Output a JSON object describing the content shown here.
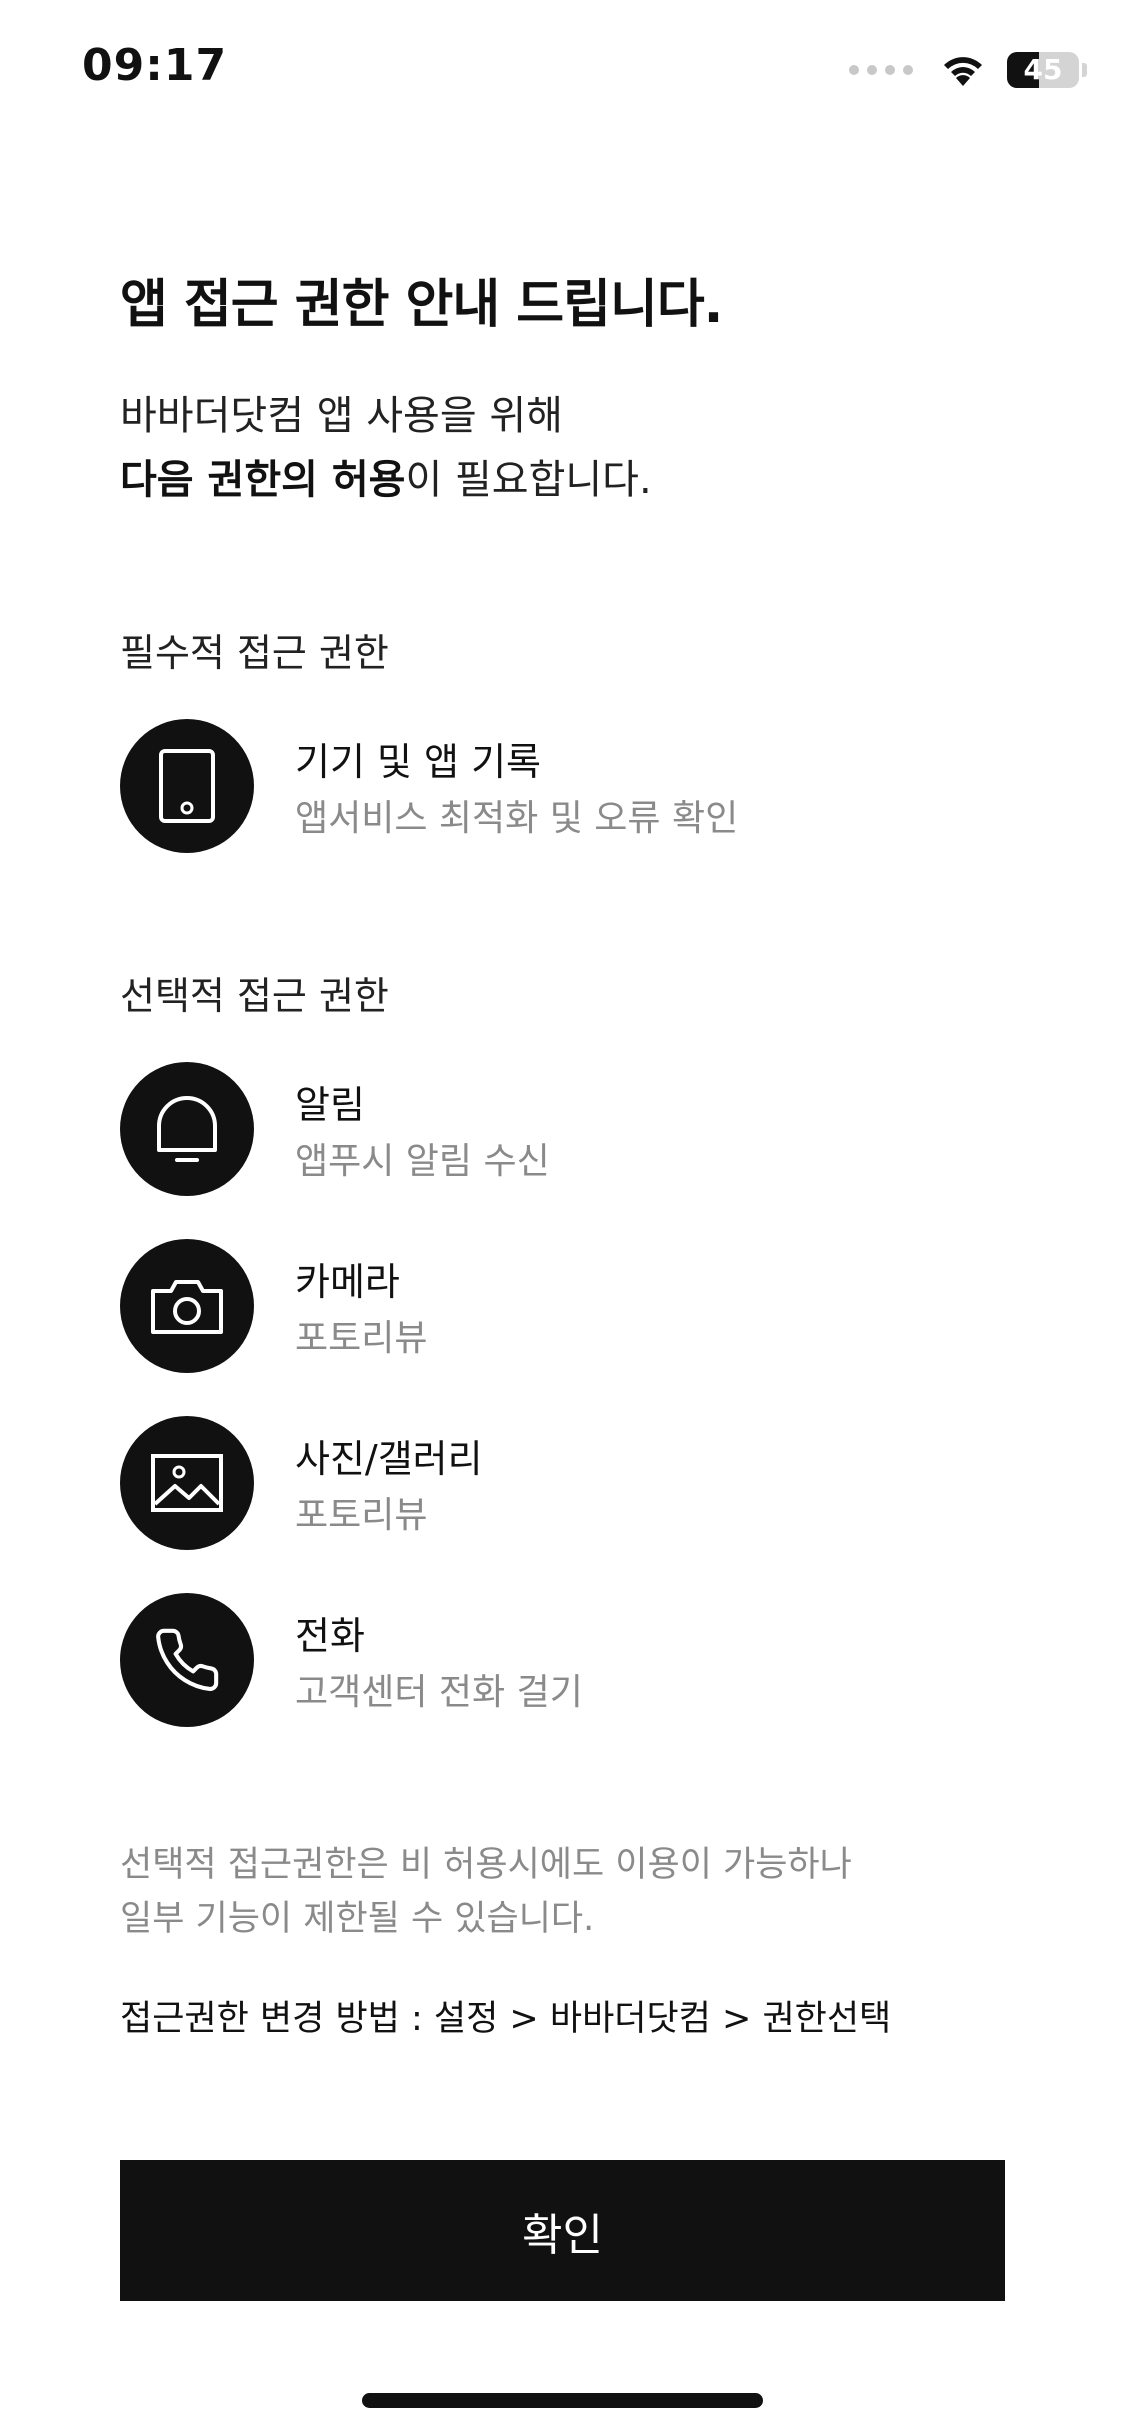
{
  "status_bar": {
    "time": "09:17",
    "battery_level": "45",
    "battery_fraction": 0.45,
    "icons": [
      "signal-dots-icon",
      "wifi-icon",
      "battery-icon"
    ]
  },
  "title": "앱 접근 권한 안내 드립니다.",
  "intro": {
    "line1": "바바더닷컴 앱 사용을 위해",
    "line2_bold": "다음 권한의 허용",
    "line2_rest": "이 필요합니다."
  },
  "required_section": {
    "title": "필수적 접근 권한",
    "items": [
      {
        "name": "기기 및 앱 기록",
        "desc": "앱서비스 최적화 및 오류 확인",
        "icon": "phone-device-icon"
      }
    ]
  },
  "optional_section": {
    "title": "선택적 접근 권한",
    "items": [
      {
        "name": "알림",
        "desc": "앱푸시 알림 수신",
        "icon": "bell-icon"
      },
      {
        "name": "카메라",
        "desc": "포토리뷰",
        "icon": "camera-icon"
      },
      {
        "name": "사진/갤러리",
        "desc": "포토리뷰",
        "icon": "image-icon"
      },
      {
        "name": "전화",
        "desc": "고객센터 전화 걸기",
        "icon": "phone-call-icon"
      }
    ]
  },
  "notice": {
    "line1": "선택적 접근권한은 비 허용시에도 이용이 가능하나",
    "line2": "일부 기능이 제한될 수 있습니다."
  },
  "howto": "접근권한 변경 방법 : 설정 > 바바더닷컴 > 권한선택",
  "confirm_button": "확인",
  "colors": {
    "background": "#ffffff",
    "primary_text": "#111111",
    "secondary_text": "#8a8a8a",
    "button_bg": "#111111",
    "button_text": "#ffffff"
  }
}
